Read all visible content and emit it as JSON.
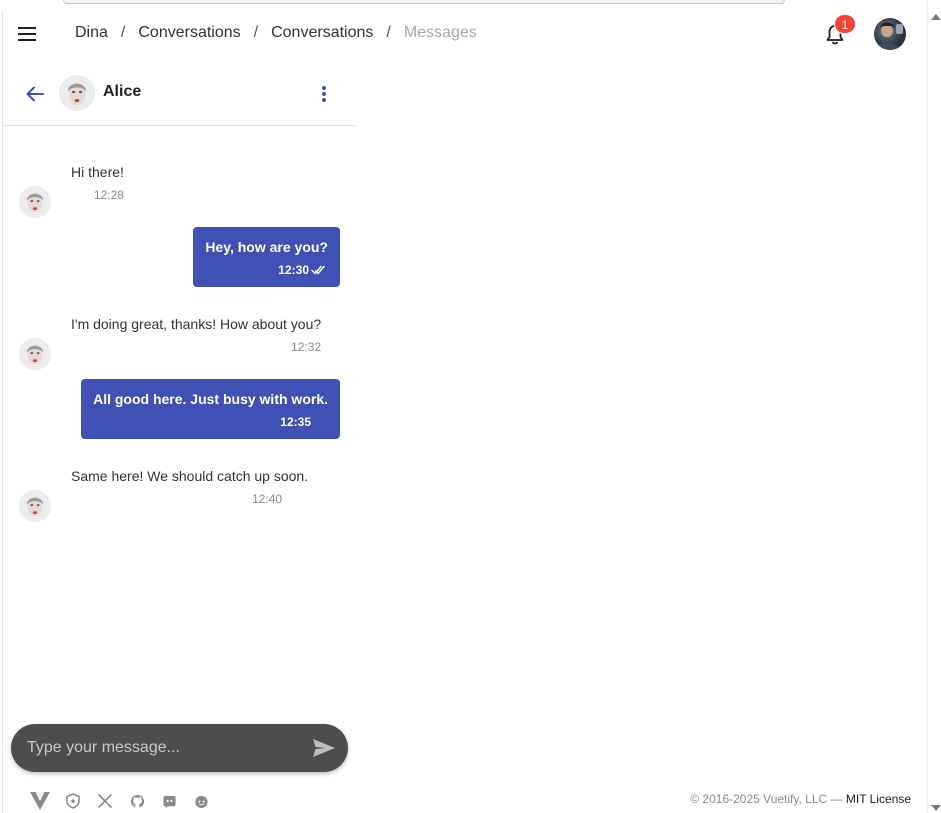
{
  "appbar": {
    "breadcrumbs": [
      {
        "label": "Dina",
        "disabled": false
      },
      {
        "label": "Conversations",
        "disabled": false
      },
      {
        "label": "Conversations",
        "disabled": false
      },
      {
        "label": "Messages",
        "disabled": true
      }
    ],
    "separator": "/",
    "notification_count": "1",
    "icons": {
      "menu": "menu-icon",
      "bell": "bell-icon"
    }
  },
  "chat": {
    "contact_name": "Alice",
    "messages": [
      {
        "from": "contact",
        "text": "Hi there!",
        "time": "12:28"
      },
      {
        "from": "me",
        "text": "Hey, how are you?",
        "time": "12:30",
        "read": true
      },
      {
        "from": "contact",
        "text": "I'm doing great, thanks! How about you?",
        "time": "12:32"
      },
      {
        "from": "me",
        "text": "All good here. Just busy with work.",
        "time": "12:35",
        "read": false
      },
      {
        "from": "contact",
        "text": "Same here! We should catch up soon.",
        "time": "12:40"
      }
    ]
  },
  "composer": {
    "placeholder": "Type your message...",
    "value": ""
  },
  "footer": {
    "copyright": "© 2016-2025 Vuetify, LLC —",
    "license": "MIT License",
    "icons": [
      "vuetify-logo",
      "shield-icon",
      "x-icon",
      "github-icon",
      "discord-icon",
      "reddit-icon"
    ]
  },
  "colors": {
    "primary": "#3f51b5",
    "badge": "#f44336",
    "composer": "#4d4d4d"
  }
}
